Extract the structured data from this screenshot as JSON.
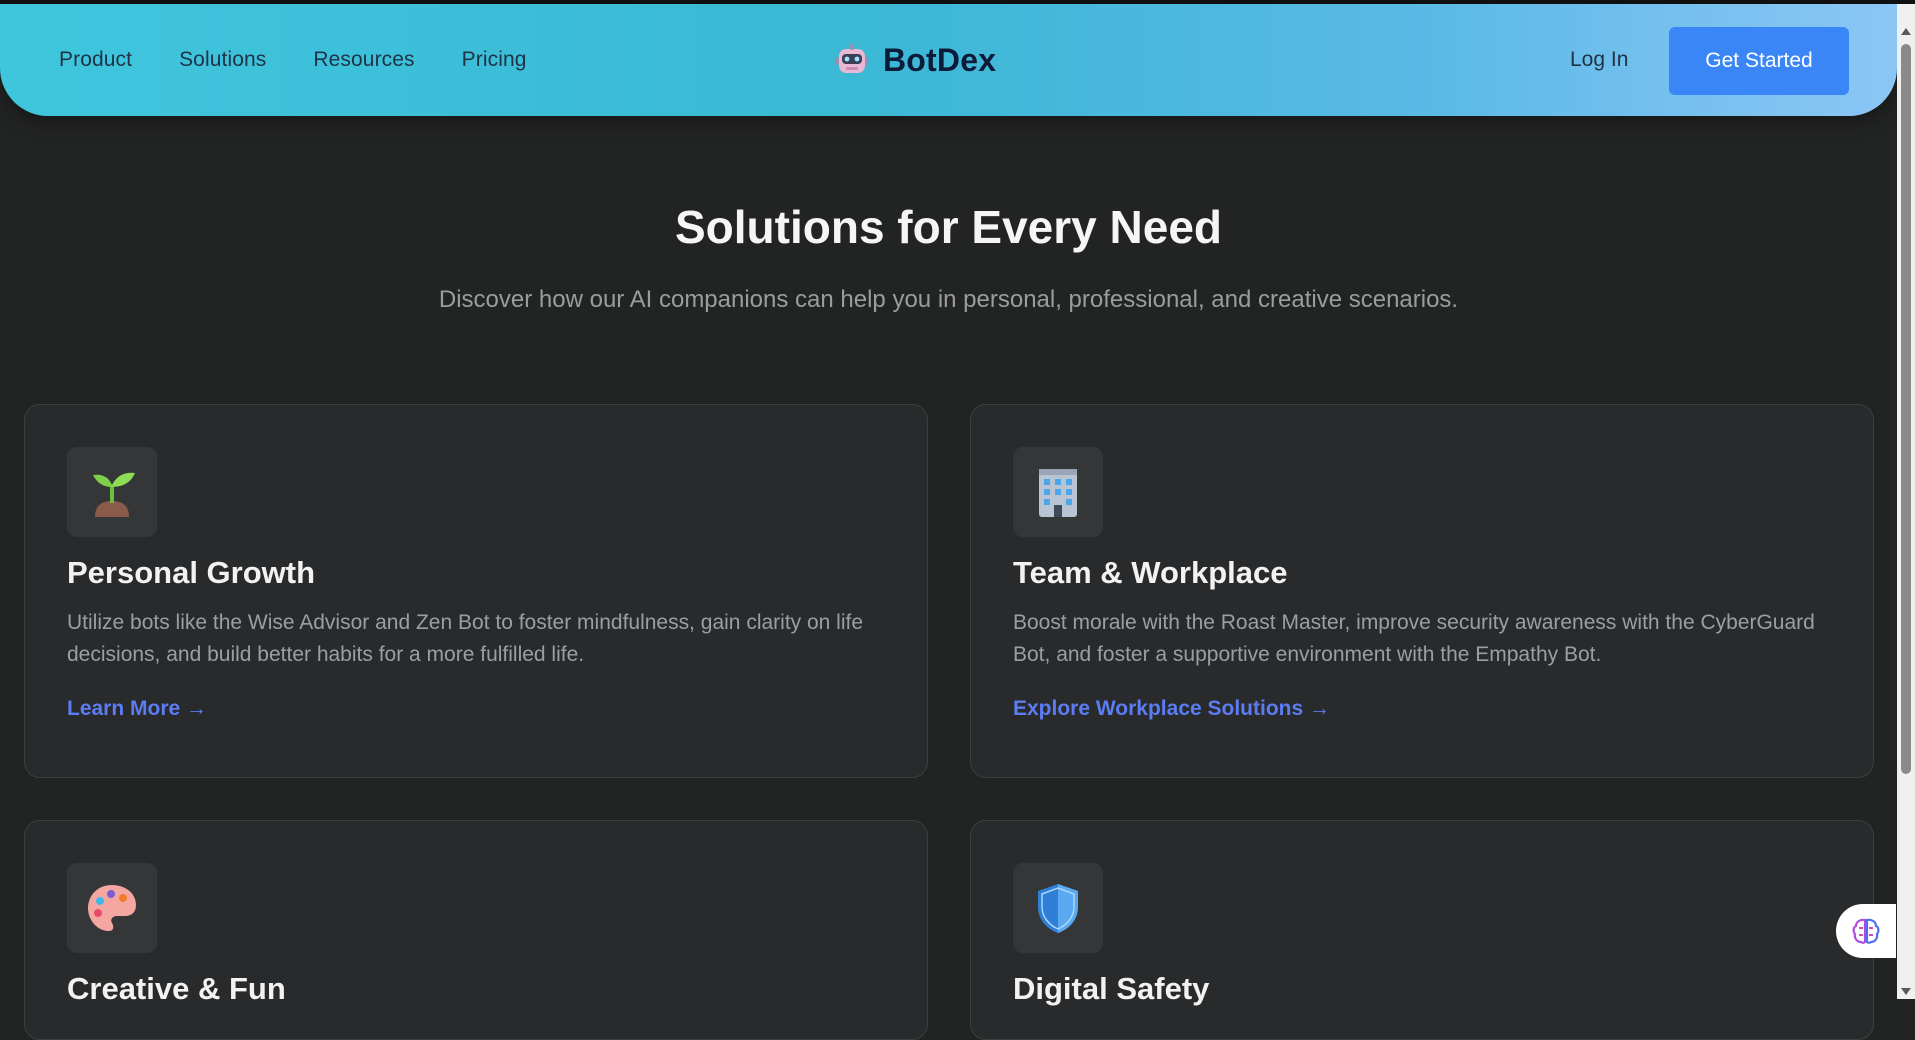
{
  "header": {
    "nav": [
      "Product",
      "Solutions",
      "Resources",
      "Pricing"
    ],
    "logo_text": "BotDex",
    "login_label": "Log In",
    "cta_label": "Get Started"
  },
  "section": {
    "title": "Solutions for Every Need",
    "subtitle": "Discover how our AI companions can help you in personal, professional, and creative scenarios."
  },
  "cards": [
    {
      "icon": "seedling-icon",
      "title": "Personal Growth",
      "description": "Utilize bots like the Wise Advisor and Zen Bot to foster mindfulness, gain clarity on life decisions, and build better habits for a more fulfilled life.",
      "link": "Learn More →"
    },
    {
      "icon": "office-building-icon",
      "title": "Team & Workplace",
      "description": "Boost morale with the Roast Master, improve security awareness with the CyberGuard Bot, and foster a supportive environment with the Empathy Bot.",
      "link": "Explore Workplace Solutions →"
    },
    {
      "icon": "artist-palette-icon",
      "title": "Creative & Fun"
    },
    {
      "icon": "shield-icon",
      "title": "Digital Safety"
    }
  ],
  "colors": {
    "header_gradient_start": "#3fc6dd",
    "header_gradient_end": "#8cc6f5",
    "cta": "#3b86f7",
    "link": "#5b7cf3",
    "page_bg": "#222323",
    "card_bg": "#282a2b"
  }
}
